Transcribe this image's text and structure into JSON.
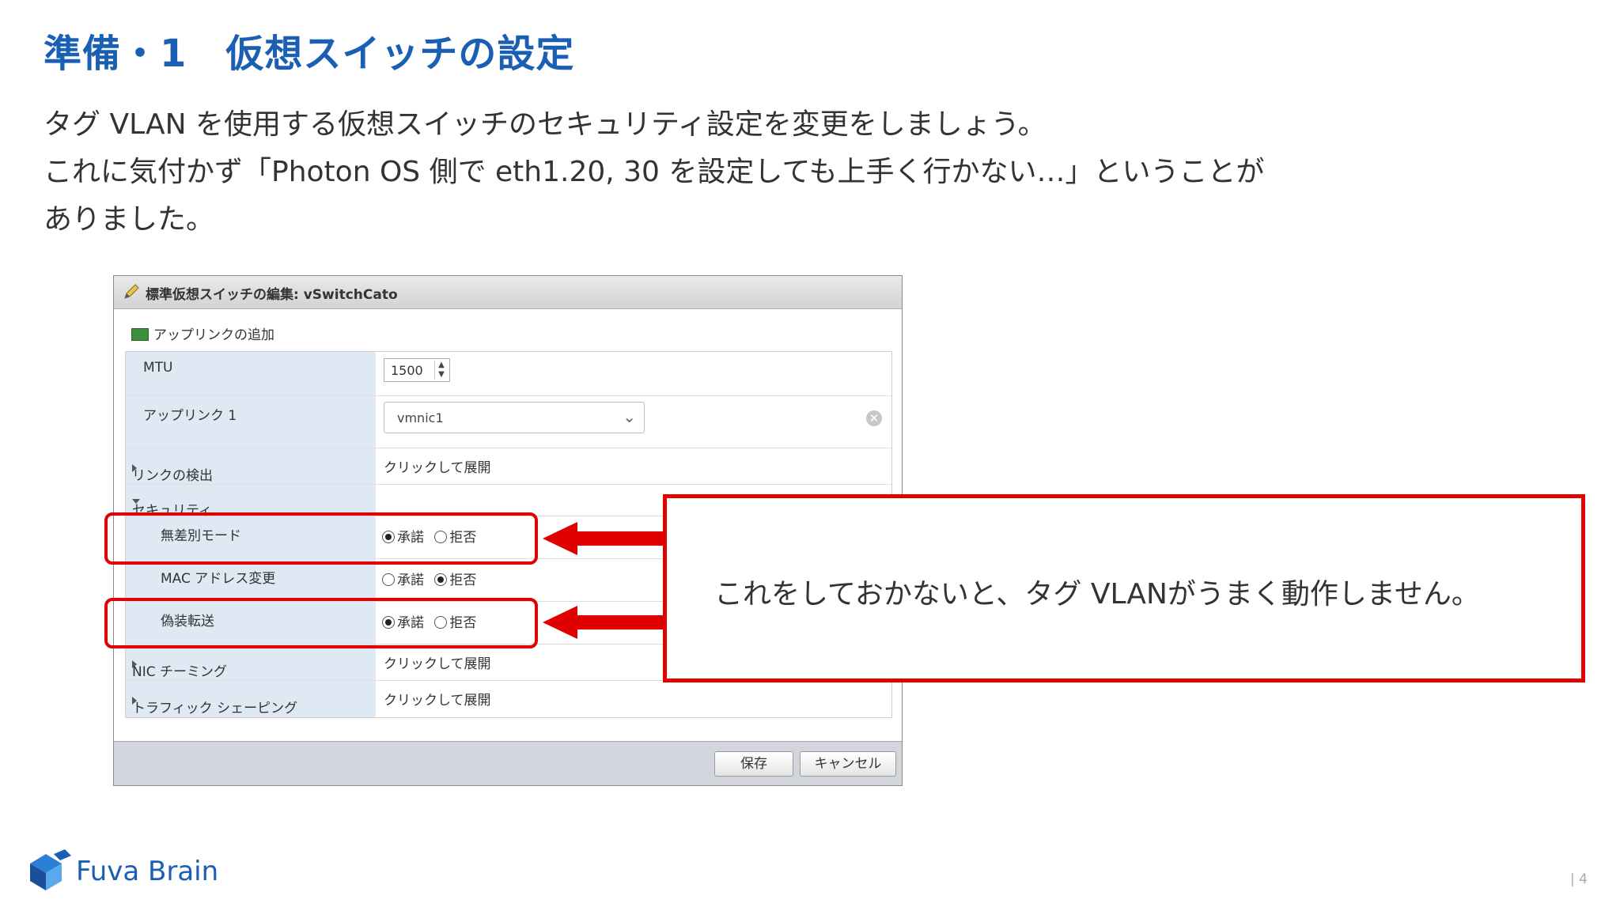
{
  "slide": {
    "title": "準備・1　仮想スイッチの設定",
    "intro_lines": [
      "タグ VLAN を使用する仮想スイッチのセキュリティ設定を変更をしましょう。",
      "これに気付かず「Photon OS 側で eth1.20, 30 を設定しても上手く行かない…」ということが",
      "ありました。"
    ],
    "page_number": "| 4"
  },
  "dialog": {
    "title": "標準仮想スイッチの編集: vSwitchCato",
    "add_uplink": "アップリンクの追加",
    "rows": {
      "mtu_label": "MTU",
      "mtu_value": "1500",
      "uplink_label": "アップリンク 1",
      "uplink_value": "vmnic1",
      "link_discovery_label": "リンクの検出",
      "link_discovery_value": "クリックして展開",
      "security_label": "セキュリティ",
      "promiscuous_label": "無差別モード",
      "mac_change_label": "MAC アドレス変更",
      "forged_label": "偽装転送",
      "nic_teaming_label": "NIC チーミング",
      "nic_teaming_value": "クリックして展開",
      "traffic_shaping_label": "トラフィック シェーピング",
      "traffic_shaping_value": "クリックして展開"
    },
    "radio": {
      "accept": "承諾",
      "reject": "拒否"
    },
    "settings": {
      "promiscuous": "accept",
      "mac_change": "reject",
      "forged": "accept"
    },
    "buttons": {
      "save": "保存",
      "cancel": "キャンセル"
    }
  },
  "callout": {
    "text": "これをしておかないと、タグ VLANがうまく動作しません。"
  },
  "logo": {
    "text": "Fuva Brain"
  },
  "colors": {
    "title": "#1a5fb4",
    "highlight": "#e00000",
    "label_bg": "#dfe9f3"
  }
}
